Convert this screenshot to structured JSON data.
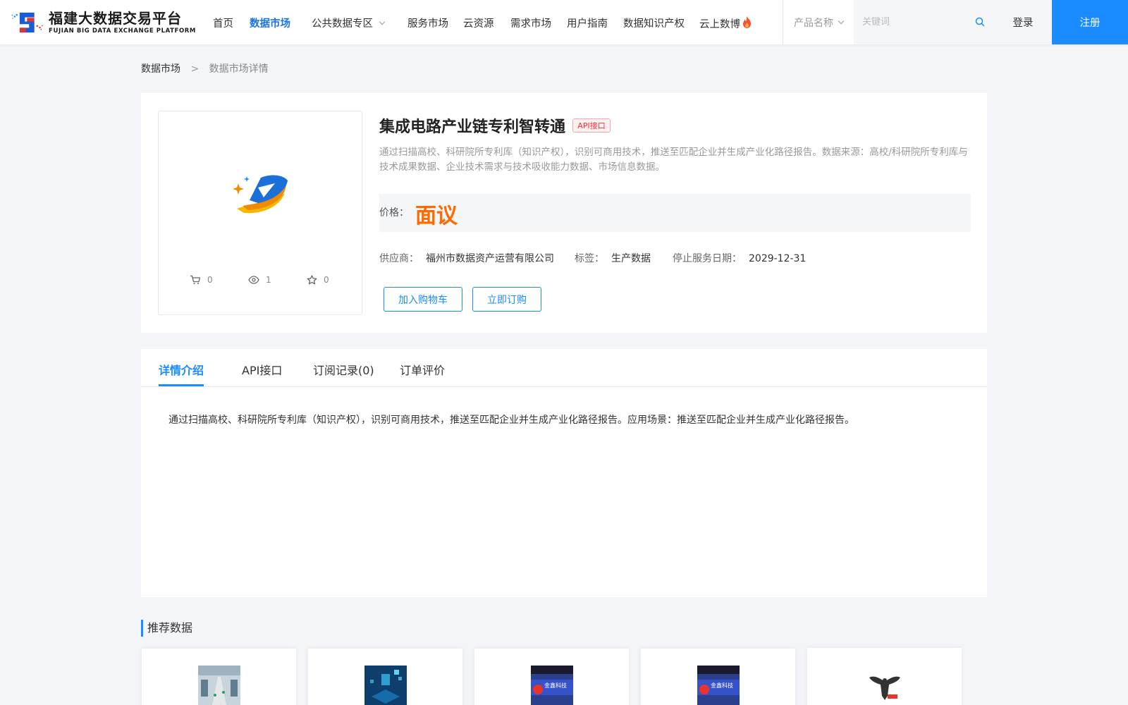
{
  "header": {
    "logo_cn": "福建大数据交易平台",
    "logo_en": "FUJIAN BIG DATA EXCHANGE PLATFORM",
    "nav": [
      {
        "label": "首页",
        "active": false
      },
      {
        "label": "数据市场",
        "active": true
      },
      {
        "label": "公共数据专区",
        "active": false,
        "has_dropdown": true
      },
      {
        "label": "服务市场",
        "active": false
      },
      {
        "label": "云资源",
        "active": false
      },
      {
        "label": "需求市场",
        "active": false
      },
      {
        "label": "用户指南",
        "active": false
      },
      {
        "label": "数据知识产权",
        "active": false
      },
      {
        "label": "云上数博",
        "active": false,
        "icon": "fire-icon"
      }
    ],
    "search_type": "产品名称",
    "search_placeholder": "关键词",
    "login": "登录",
    "register": "注册"
  },
  "breadcrumb": {
    "root": "数据市场",
    "separator": ">",
    "current": "数据市场详情"
  },
  "product": {
    "title": "集成电路产业链专利智转通",
    "badge": "API接口",
    "description": "通过扫描高校、科研院所专利库（知识产权），识别可商用技术，推送至匹配企业并生成产业化路径报告。数据来源：高校/科研院所专利库与技术成果数据、企业技术需求与技术吸收能力数据、市场信息数据。",
    "price_label": "价格：",
    "price_value": "面议",
    "stats": {
      "cart": "0",
      "views": "1",
      "favorites": "0"
    },
    "supplier_label": "供应商：",
    "supplier": "福州市数据资产运营有限公司",
    "tag_label": "标签：",
    "tag": "生产数据",
    "end_date_label": "停止服务日期：",
    "end_date": "2029-12-31",
    "add_to_cart": "加入购物车",
    "subscribe": "立即订购"
  },
  "tabs": [
    {
      "label": "详情介绍",
      "active": true
    },
    {
      "label": "API接口",
      "active": false
    },
    {
      "label": "订阅记录(0)",
      "active": false
    },
    {
      "label": "订单评价",
      "active": false
    }
  ],
  "detail_text": "通过扫描高校、科研院所专利库（知识产权），识别可商用技术，推送至匹配企业并生成产业化路径报告。应用场景：推送至匹配企业并生成产业化路径报告。",
  "recommended": {
    "title": "推荐数据",
    "thumb_text_jinxin": "金鑫科技"
  },
  "colors": {
    "primary": "#1a8cff",
    "price": "#ff6a00",
    "badge": "#f0303e"
  }
}
